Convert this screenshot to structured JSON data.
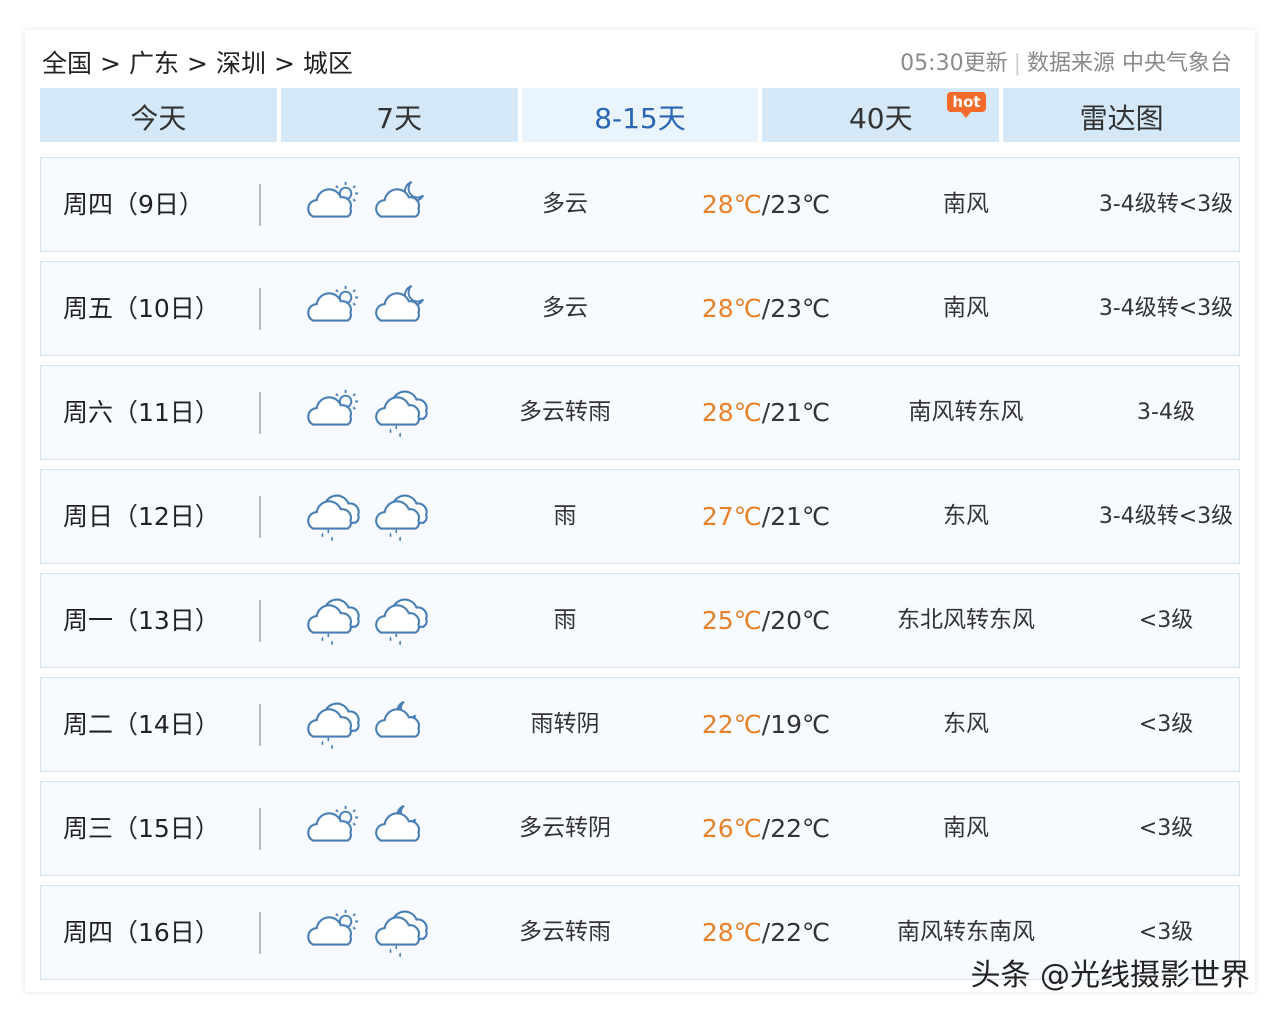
{
  "breadcrumb": [
    "全国",
    "广东",
    "深圳",
    "城区"
  ],
  "breadcrumb_separator": ">",
  "header_meta": {
    "updated": "05:30更新",
    "source": "数据来源 中央气象台"
  },
  "tabs": [
    {
      "label": "今天",
      "active": false
    },
    {
      "label": "7天",
      "active": false
    },
    {
      "label": "8-15天",
      "active": true
    },
    {
      "label": "40天",
      "active": false,
      "badge": "hot"
    },
    {
      "label": "雷达图",
      "active": false
    }
  ],
  "forecast": [
    {
      "day": "周四（9日）",
      "icon_day": "partly-cloudy-day-icon",
      "icon_night": "cloudy-night-icon",
      "desc": "多云",
      "high": "28℃",
      "low": "23℃",
      "wind": "南风",
      "level": "3-4级转<3级"
    },
    {
      "day": "周五（10日）",
      "icon_day": "partly-cloudy-day-icon",
      "icon_night": "cloudy-night-icon",
      "desc": "多云",
      "high": "28℃",
      "low": "23℃",
      "wind": "南风",
      "level": "3-4级转<3级"
    },
    {
      "day": "周六（11日）",
      "icon_day": "partly-cloudy-day-icon",
      "icon_night": "rain-icon",
      "desc": "多云转雨",
      "high": "28℃",
      "low": "21℃",
      "wind": "南风转东风",
      "level": "3-4级"
    },
    {
      "day": "周日（12日）",
      "icon_day": "rain-icon",
      "icon_night": "rain-icon",
      "desc": "雨",
      "high": "27℃",
      "low": "21℃",
      "wind": "东风",
      "level": "3-4级转<3级"
    },
    {
      "day": "周一（13日）",
      "icon_day": "rain-icon",
      "icon_night": "rain-icon",
      "desc": "雨",
      "high": "25℃",
      "low": "20℃",
      "wind": "东北风转东风",
      "level": "<3级"
    },
    {
      "day": "周二（14日）",
      "icon_day": "rain-icon",
      "icon_night": "overcast-night-icon",
      "desc": "雨转阴",
      "high": "22℃",
      "low": "19℃",
      "wind": "东风",
      "level": "<3级"
    },
    {
      "day": "周三（15日）",
      "icon_day": "partly-cloudy-day-icon",
      "icon_night": "overcast-night-icon",
      "desc": "多云转阴",
      "high": "26℃",
      "low": "22℃",
      "wind": "南风",
      "level": "<3级"
    },
    {
      "day": "周四（16日）",
      "icon_day": "partly-cloudy-day-icon",
      "icon_night": "rain-icon",
      "desc": "多云转雨",
      "high": "28℃",
      "low": "22℃",
      "wind": "南风转东南风",
      "level": "<3级"
    }
  ],
  "temp_separator": "/",
  "watermark": "头条 @光线摄影世界",
  "colors": {
    "tab_bg": "#d5e8f8",
    "tab_active_text": "#2a66b4",
    "high_temp": "#e8812a",
    "icon_stroke": "#4a7fb5",
    "hot_badge": "#f36a2a"
  }
}
